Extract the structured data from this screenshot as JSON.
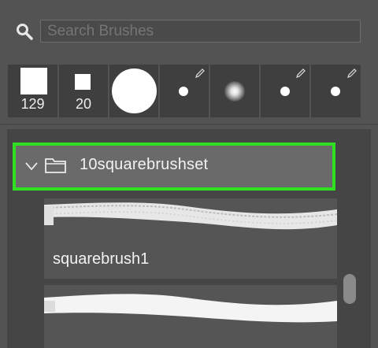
{
  "search": {
    "placeholder": "Search Brushes",
    "icon": "search-icon"
  },
  "recent_brushes": [
    {
      "shape": "hard-square",
      "size_label": "129",
      "editable": false
    },
    {
      "shape": "hard-square",
      "size_label": "20",
      "editable": false
    },
    {
      "shape": "hard-round",
      "size_label": "",
      "editable": false
    },
    {
      "shape": "hard-round",
      "size_label": "",
      "editable": true
    },
    {
      "shape": "soft-round",
      "size_label": "",
      "editable": false
    },
    {
      "shape": "hard-round",
      "size_label": "",
      "editable": true
    },
    {
      "shape": "hard-round",
      "size_label": "",
      "editable": true
    }
  ],
  "brush_group": {
    "name": "10squarebrushset",
    "expanded": true,
    "highlight_color": "#2ee020"
  },
  "brushes": [
    {
      "name": "squarebrush1"
    },
    {
      "name": ""
    }
  ],
  "colors": {
    "panel_bg": "#535353",
    "list_bg": "#454545",
    "group_bg": "#6a6a6a",
    "accent_highlight": "#2ee020"
  }
}
